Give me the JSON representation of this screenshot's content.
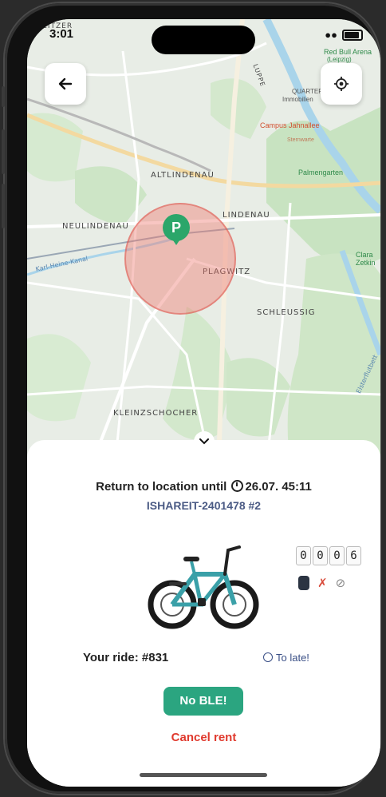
{
  "status_bar": {
    "time": "3:01"
  },
  "map": {
    "labels": {
      "altlindenau": "ALTLINDENAU",
      "neulindenau": "NEULINDENAU",
      "lindenau": "LINDENAU",
      "plagwitz": "PLAGWITZ",
      "schleussig": "SCHLEUSSIG",
      "kleinzschocher": "KLEINZSCHOCHER",
      "karl_heine_kanal": "Karl-Heine-Kanal",
      "zeitzer": "ZEITZER",
      "luppe": "LUPPE",
      "elsterflutbett": "Elsterflutbett"
    },
    "pois": {
      "red_bull_arena": "Red Bull Arena",
      "red_bull_arena_sub": "(Leipzig)",
      "quarterback": "QUARTERBACK",
      "quarterback_sub": "Immobilien",
      "campus_jahnallee": "Campus Jahnallee",
      "campus_sub": "Sternwarte",
      "palmengarten": "Palmengarten",
      "clara": "Clara",
      "clara_sub": "Zetkin"
    },
    "pin_symbol": "P",
    "zone_color": "#ee786e"
  },
  "sheet": {
    "return_label": "Return to location until",
    "return_date": "26.07. 45:11",
    "vehicle_id": "ISHAREIT-2401478 #2",
    "code": [
      "0",
      "0",
      "0",
      "6"
    ],
    "ride_label": "Your ride: #831",
    "late_status": "To late!",
    "no_ble_button": "No BLE!",
    "cancel_link": "Cancel rent"
  },
  "icons": {
    "back": "arrow-left-icon",
    "locate": "crosshair-icon",
    "collapse": "chevron-down-icon",
    "lock": "lock-icon",
    "ble_off": "bluetooth-off-icon",
    "no_gps": "gps-off-icon"
  },
  "colors": {
    "accent_green": "#2ba580",
    "cancel_red": "#e03a2e",
    "id_blue": "#4a5a84",
    "bike_teal": "#3aa0a8"
  }
}
